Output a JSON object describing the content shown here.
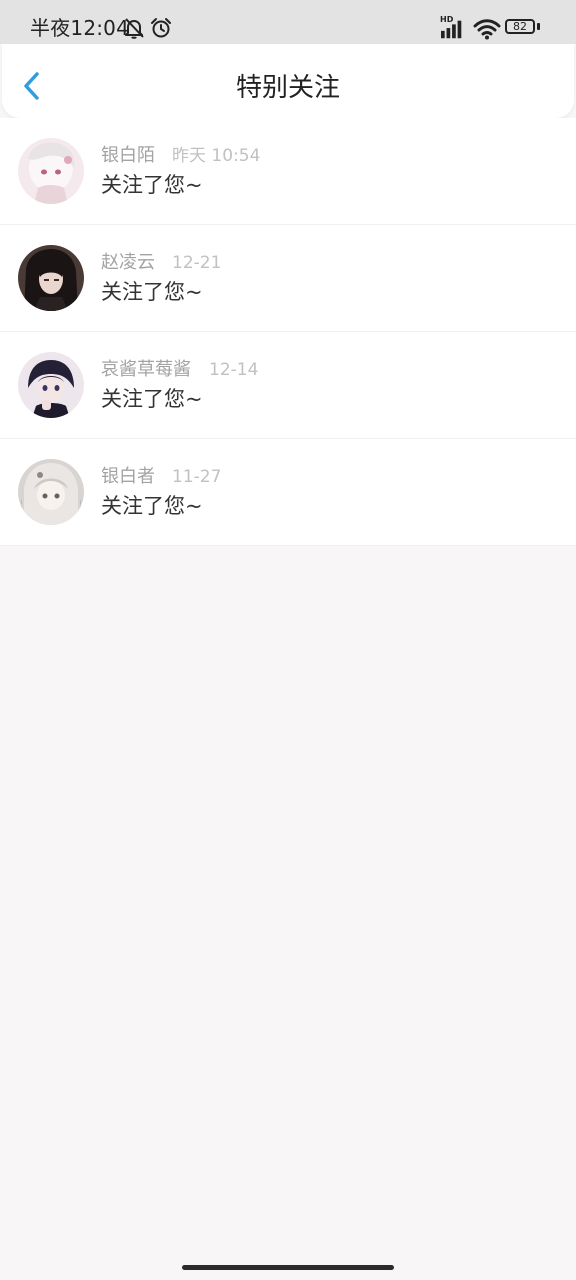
{
  "status_bar": {
    "time": "半夜12:04",
    "hd_label": "HD",
    "battery_level": "82",
    "icons": [
      "bell-off-icon",
      "alarm-clock-icon",
      "signal-icon",
      "wifi-icon",
      "battery-icon"
    ]
  },
  "header": {
    "title": "特别关注",
    "back_icon": "chevron-left-icon",
    "accent_color": "#2f9ee0"
  },
  "notifications": [
    {
      "name": "银白陌",
      "time": "昨天 10:54",
      "message": "关注了您~"
    },
    {
      "name": "赵凌云",
      "time": "12-21",
      "message": "关注了您~"
    },
    {
      "name": "哀酱草莓酱",
      "time": "12-14",
      "message": "关注了您~"
    },
    {
      "name": "银白者",
      "time": "11-27",
      "message": "关注了您~"
    }
  ]
}
